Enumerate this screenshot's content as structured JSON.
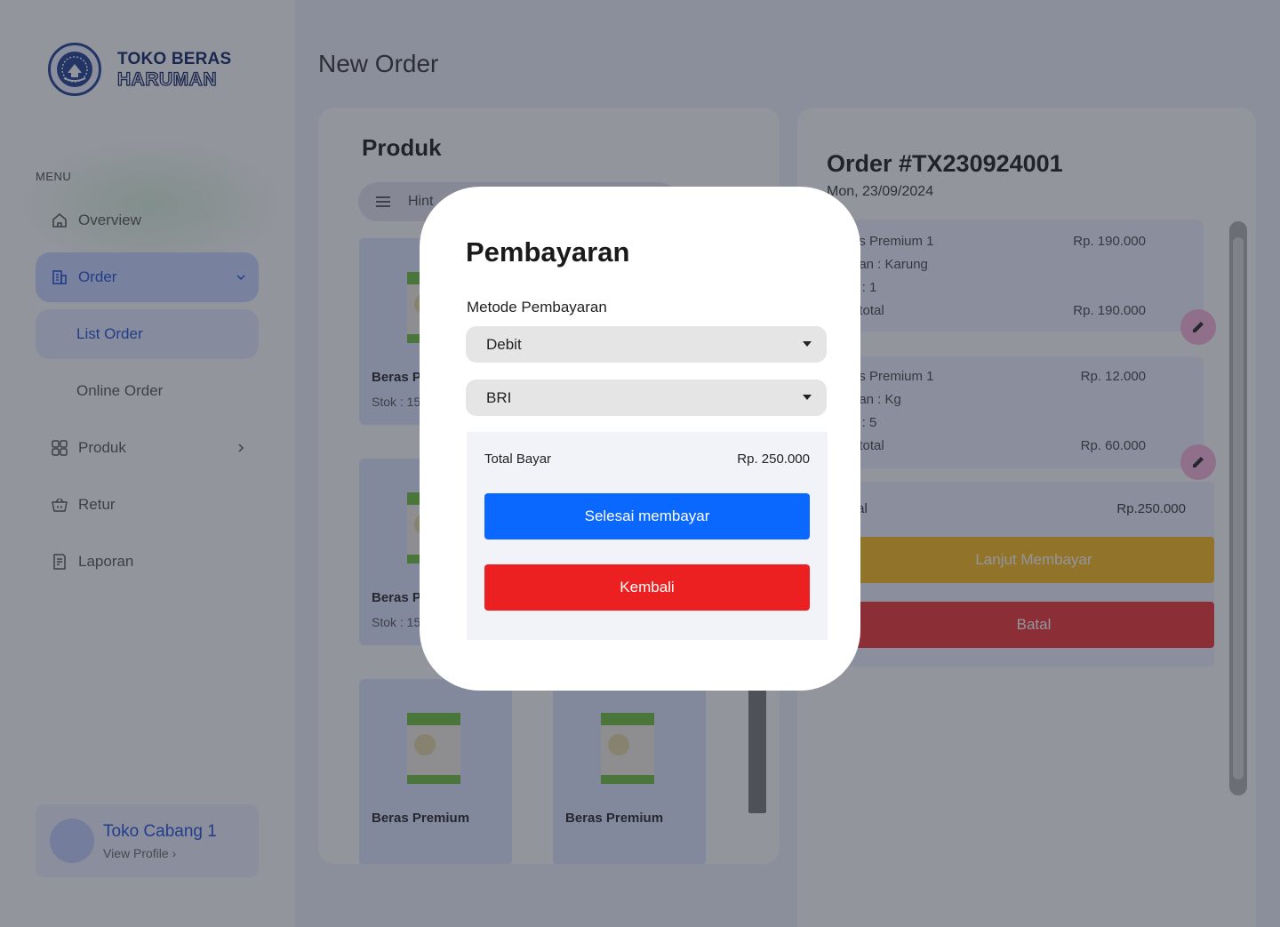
{
  "brand": {
    "line1": "TOKO BERAS",
    "line2": "HARUMAN"
  },
  "sidebar": {
    "menu_title": "MENU",
    "items": [
      {
        "label": "Overview"
      },
      {
        "label": "Order"
      },
      {
        "label": "List Order"
      },
      {
        "label": "Online Order"
      },
      {
        "label": "Produk"
      },
      {
        "label": "Retur"
      },
      {
        "label": "Laporan"
      }
    ],
    "profile": {
      "name": "Toko Cabang 1",
      "link": "View Profile"
    }
  },
  "page": {
    "title": "New Order"
  },
  "products": {
    "title": "Produk",
    "search_placeholder": "Hint",
    "cards": [
      {
        "name": "Beras Pr",
        "stock": "Stok : 15"
      },
      {
        "name": "Beras Pr",
        "stock": "Stok : 15"
      },
      {
        "name": "Beras Premium",
        "stock": ""
      },
      {
        "name": "Beras Premium",
        "stock": ""
      }
    ]
  },
  "order": {
    "id": "Order #TX230924001",
    "date": "Mon, 23/09/2024",
    "lines": [
      {
        "name": "as Premium 1",
        "variant": "rian  : Karung",
        "qty": "y : 1",
        "subtotal_label": "ototal",
        "price": "Rp. 190.000",
        "subtotal": "Rp. 190.000"
      },
      {
        "name": "as Premium 1",
        "variant": "rian  : Kg",
        "qty": "y : 5",
        "subtotal_label": "ototal",
        "price": "Rp. 12.000",
        "subtotal": "Rp. 60.000"
      }
    ],
    "total_label": "tal",
    "total_value": "Rp.250.000",
    "btn_lanjut": "Lanjut Membayar",
    "btn_batal": "Batal"
  },
  "modal": {
    "title": "Pembayaran",
    "method_label": "Metode Pembayaran",
    "method_value": "Debit",
    "bank_value": "BRI",
    "total_label": "Total Bayar",
    "total_value": "Rp. 250.000",
    "btn_done": "Selesai membayar",
    "btn_back": "Kembali"
  },
  "colors": {
    "primary_blue": "#0a68ff",
    "danger_red": "#ec2020",
    "warning_yellow": "#fcbb18",
    "brand_navy": "#0d2360",
    "nav_active": "#1c4fd6"
  }
}
